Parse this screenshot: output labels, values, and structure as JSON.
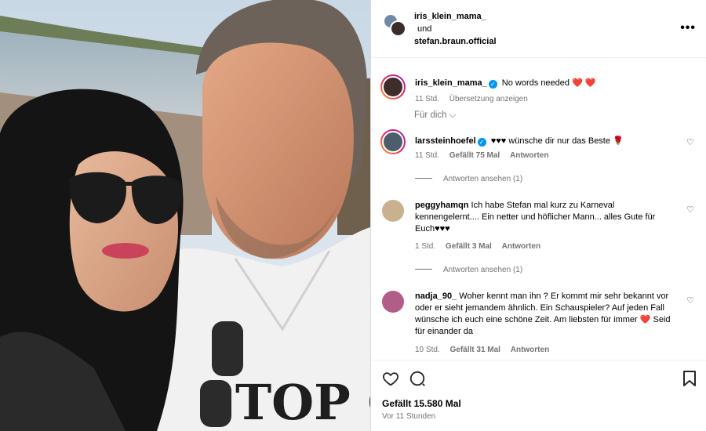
{
  "header": {
    "user1": "iris_klein_mama_",
    "conj": "und",
    "user2": "stefan.braun.official",
    "more_label": "•••"
  },
  "caption": {
    "user": "iris_klein_mama_",
    "text": "No words needed",
    "emoji": "❤️ ❤️",
    "time": "11 Std.",
    "translate": "Übersetzung anzeigen"
  },
  "filter_label": "Für dich",
  "comments": [
    {
      "user": "larssteinhoefel",
      "verified": true,
      "text_prefix": "♥♥♥",
      "text": "wünsche dir nur das Beste 🌹",
      "time": "11 Std.",
      "likes": "Gefällt 75 Mal",
      "reply": "Antworten",
      "view_replies": "Antworten ansehen (1)"
    },
    {
      "user": "peggyhamqn",
      "text": "Ich habe Stefan mal kurz zu Karneval kennengelernt.... Ein netter und höflicher Mann... alles Gute für Euch♥♥♥",
      "time": "1 Std.",
      "likes": "Gefällt 3 Mal",
      "reply": "Antworten",
      "view_replies": "Antworten ansehen (1)"
    },
    {
      "user": "nadja_90_",
      "text": "Woher kennt man ihn ? Er kommt mir sehr bekannt vor oder er sieht jemandem ähnlich. Ein Schauspieler? Auf jeden Fall wünsche ich euch eine schöne Zeit. Am liebsten für immer ",
      "text_heart": "❤️",
      "text_suffix": " Seid für einander da",
      "time": "10 Std.",
      "likes": "Gefällt 31 Mal",
      "reply": "Antworten"
    }
  ],
  "footer": {
    "likes": "Gefällt 15.580 Mal",
    "ago": "Vor 11 Stunden"
  },
  "photo": {
    "shirt_text": "TOP GUN"
  }
}
